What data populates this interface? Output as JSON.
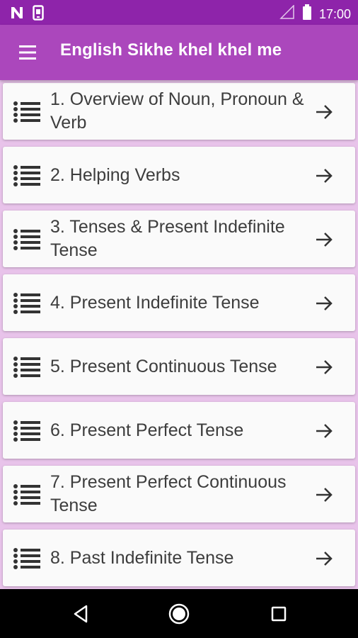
{
  "status_bar": {
    "time": "17:00",
    "icons": [
      "n-notification-icon",
      "phone-notification-icon",
      "signal-icon",
      "battery-icon"
    ]
  },
  "app_bar": {
    "title": "English Sikhe khel khel me",
    "menu_icon": "hamburger-menu-icon"
  },
  "lessons": [
    {
      "label": "1. Overview of Noun, Pronoun & Verb"
    },
    {
      "label": "2. Helping Verbs"
    },
    {
      "label": "3. Tenses & Present Indefinite Tense"
    },
    {
      "label": "4. Present Indefinite Tense"
    },
    {
      "label": "5. Present Continuous Tense"
    },
    {
      "label": "6. Present Perfect Tense"
    },
    {
      "label": "7. Present Perfect Continuous Tense"
    },
    {
      "label": "8. Past Indefinite Tense"
    }
  ],
  "nav_bar": {
    "icons": [
      "back-icon",
      "home-icon",
      "recents-icon"
    ]
  },
  "colors": {
    "status_bar": "#8e24aa",
    "app_bar": "#ab47bc",
    "list_background": "#e8c3ea",
    "card": "#fafafa"
  }
}
